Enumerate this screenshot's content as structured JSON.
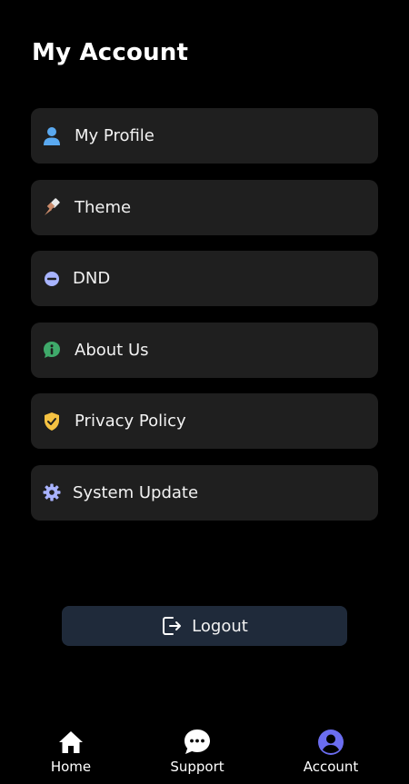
{
  "header": {
    "title": "My Account"
  },
  "menu": {
    "items": [
      {
        "label": "My Profile",
        "icon": "person-icon",
        "color": "#5aa9f0"
      },
      {
        "label": "Theme",
        "icon": "paint-brush-icon",
        "color": "#c98a6a"
      },
      {
        "label": "DND",
        "icon": "minus-circle-icon",
        "color": "#a8b4ff"
      },
      {
        "label": "About Us",
        "icon": "info-icon",
        "color": "#3fa96a"
      },
      {
        "label": "Privacy Policy",
        "icon": "shield-check-icon",
        "color": "#f5c242"
      },
      {
        "label": "System Update",
        "icon": "gear-icon",
        "color": "#a9b3ff"
      }
    ]
  },
  "logout": {
    "label": "Logout",
    "icon": "logout-icon"
  },
  "bottom_nav": {
    "items": [
      {
        "label": "Home",
        "icon": "home-icon",
        "active": false
      },
      {
        "label": "Support",
        "icon": "chat-bubble-icon",
        "active": false
      },
      {
        "label": "Account",
        "icon": "account-circle-icon",
        "active": true
      }
    ],
    "active_color": "#6b6df0"
  }
}
